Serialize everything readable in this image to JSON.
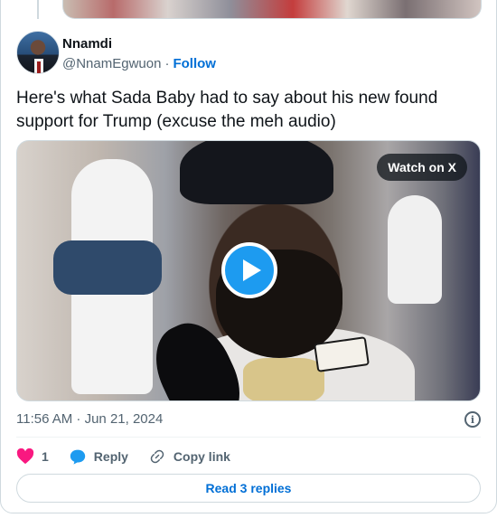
{
  "author": {
    "name": "Nnamdi",
    "handle": "@NnamEgwuon",
    "separator": "·",
    "follow_label": "Follow"
  },
  "tweet": {
    "text": "Here's what Sada Baby had to say about his new found support for Trump (excuse the meh audio)"
  },
  "media": {
    "watch_label": "Watch on X"
  },
  "meta": {
    "timestamp": "11:56 AM · Jun 21, 2024"
  },
  "actions": {
    "like_count": "1",
    "reply_label": "Reply",
    "copy_link_label": "Copy link"
  },
  "read_replies_label": "Read 3 replies",
  "colors": {
    "accent": "#1d9bf0",
    "link": "#006fd6",
    "heart": "#f91880",
    "muted": "#536471"
  }
}
